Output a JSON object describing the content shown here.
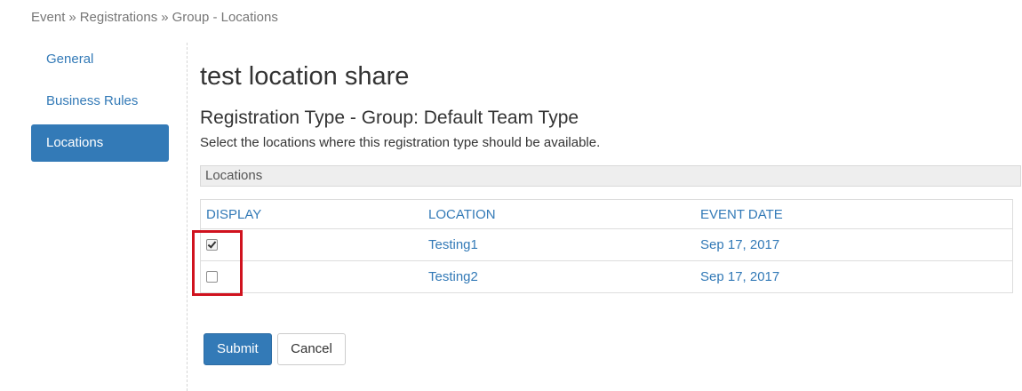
{
  "breadcrumb": {
    "items": [
      "Event",
      "Registrations",
      "Group - Locations"
    ],
    "separator": "»"
  },
  "sidebar": {
    "items": [
      {
        "label": "General",
        "active": false
      },
      {
        "label": "Business Rules",
        "active": false
      },
      {
        "label": "Locations",
        "active": true
      }
    ]
  },
  "main": {
    "title": "test location share",
    "section_title": "Registration Type - Group: Default Team Type",
    "description": "Select the locations where this registration type should be available.",
    "panel_heading": "Locations",
    "table": {
      "headers": [
        "DISPLAY",
        "LOCATION",
        "EVENT DATE"
      ],
      "rows": [
        {
          "display": true,
          "location": "Testing1",
          "event_date": "Sep 17, 2017"
        },
        {
          "display": false,
          "location": "Testing2",
          "event_date": "Sep 17, 2017"
        }
      ]
    }
  },
  "actions": {
    "submit_label": "Submit",
    "cancel_label": "Cancel"
  },
  "colors": {
    "accent": "#337ab7",
    "highlight": "#d0121e"
  }
}
